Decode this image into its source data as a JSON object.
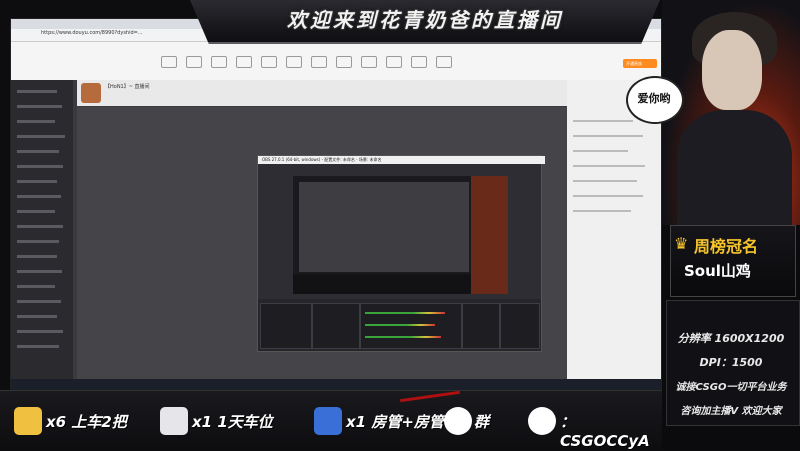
{
  "banner": {
    "title": "欢迎来到花青奶爸的直播间"
  },
  "browser": {
    "address": "https://www.douyu.com/8990?dyshid=...",
    "site_button": "开通贵族"
  },
  "room": {
    "name": "【HoN1】~ 直播间"
  },
  "obs": {
    "title": "OBS 27.0.1 (64-bit, windows) - 配置文件: 未命名 - 场景: 未命名"
  },
  "overlay": {
    "bubble": "爱你哟",
    "weekly_title": "周榜冠名",
    "weekly_name": "Soul山鸡",
    "resolution": "分辨率 1600X1200",
    "dpi": "DPI：1500",
    "service": "诚接CSGO一切平台业务",
    "contact": "咨询加主播V  欢迎大家"
  },
  "bottom": {
    "item1": "x6 上车2把",
    "item2": "x1 1天车位",
    "item3": "x1 房管+房管",
    "item3b": "群",
    "item4": "：CSGOCCyA"
  },
  "colors": {
    "gold": "#f7c52b",
    "accent": "#ff8a1f",
    "red": "#c23a1a"
  }
}
